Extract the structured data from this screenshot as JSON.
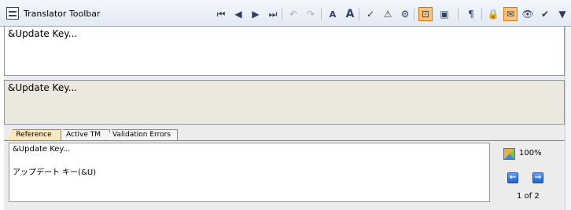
{
  "toolbar": {
    "title": "Translator Toolbar",
    "buttons": [
      {
        "name": "first-segment-icon",
        "glyph": "⏮",
        "enabled": true
      },
      {
        "name": "previous-segment-icon",
        "glyph": "◀",
        "enabled": true
      },
      {
        "name": "next-segment-icon",
        "glyph": "▶",
        "enabled": true
      },
      {
        "name": "last-segment-icon",
        "glyph": "⏭",
        "enabled": true
      },
      {
        "name": "undo-icon",
        "glyph": "↶",
        "enabled": false
      },
      {
        "name": "redo-icon",
        "glyph": "↷",
        "enabled": false
      },
      {
        "name": "decrease-font-icon",
        "glyph": "A",
        "enabled": true
      },
      {
        "name": "increase-font-icon",
        "glyph": "A",
        "enabled": true
      },
      {
        "name": "spellcheck-icon",
        "glyph": "✓",
        "enabled": true
      },
      {
        "name": "warning-icon",
        "glyph": "⚠",
        "enabled": true
      },
      {
        "name": "validate-icon",
        "glyph": "⚙",
        "enabled": true
      },
      {
        "name": "view-markup-icon",
        "glyph": "⊡",
        "enabled": true,
        "active": true
      },
      {
        "name": "insert-tag-icon",
        "glyph": "▣",
        "enabled": true
      },
      {
        "name": "paragraph-marks-icon",
        "glyph": "¶",
        "enabled": true
      },
      {
        "name": "lock-icon",
        "glyph": "🔒",
        "enabled": true
      },
      {
        "name": "email-icon",
        "glyph": "✉",
        "enabled": true,
        "active": true
      },
      {
        "name": "preview-icon",
        "glyph": "👁",
        "enabled": true
      },
      {
        "name": "approve-icon",
        "glyph": "✔",
        "enabled": true
      },
      {
        "name": "filter-icon",
        "glyph": "▼",
        "enabled": true
      }
    ]
  },
  "source": {
    "text": "&Update Key..."
  },
  "target": {
    "text": "&Update Key..."
  },
  "tabs": [
    {
      "label": "Reference",
      "active": true
    },
    {
      "label": "Active TM",
      "active": false
    },
    {
      "label": "Validation Errors",
      "active": false
    }
  ],
  "reference": {
    "source_text": "&Update Key...",
    "target_text": "アップデート キー(&U)",
    "match_percent": "100%",
    "page": "1 of 2"
  },
  "colors": {
    "target_background": "#ebe8dd",
    "active_tab": "#fbe8c0",
    "active_button": "#ffc47a"
  }
}
